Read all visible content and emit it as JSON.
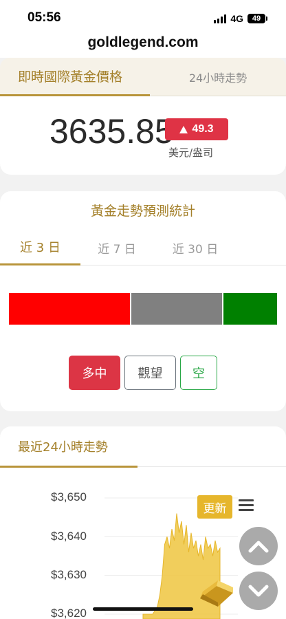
{
  "status": {
    "time": "05:56",
    "network": "4G",
    "battery": "49"
  },
  "browser": {
    "url": "goldlegend.com"
  },
  "price_card": {
    "tab_active": "即時國際黃金價格",
    "tab_other": "24小時走勢",
    "price": "3635.85",
    "change": "49.3",
    "change_direction": "up",
    "unit": "美元/盎司",
    "colors": {
      "up": "#df3345",
      "accent": "#a4802a"
    }
  },
  "forecast": {
    "title": "黃金走勢預測統計",
    "tabs": [
      {
        "label": "近 3 日",
        "active": true
      },
      {
        "label": "近 7 日",
        "active": false
      },
      {
        "label": "近 30 日",
        "active": false
      }
    ],
    "distribution": [
      {
        "name": "bullish",
        "share": 0.45,
        "color": "#ff0000"
      },
      {
        "name": "neutral",
        "share": 0.35,
        "color": "#808080"
      },
      {
        "name": "bearish",
        "share": 0.2,
        "color": "#008000"
      }
    ],
    "buttons": {
      "bull": "多中",
      "watch": "觀望",
      "bear": "空"
    }
  },
  "chart_section": {
    "tab": "最近24小時走勢",
    "update_label": "更新",
    "menu_icon": "hamburger-menu-icon",
    "y_ticks": [
      "$3,650",
      "$3,640",
      "$3,630",
      "$3,620"
    ],
    "scroll_up_icon": "chevron-up-icon",
    "scroll_down_icon": "chevron-down-icon"
  },
  "chart_data": {
    "type": "area",
    "y_ticks": [
      3650,
      3640,
      3630,
      3620
    ],
    "ylim": [
      3620,
      3650
    ],
    "values": [
      3620,
      3620,
      3620,
      3620,
      3620,
      3621,
      3622,
      3625,
      3630,
      3638,
      3640,
      3637,
      3642,
      3639,
      3646,
      3641,
      3644,
      3638,
      3643,
      3636,
      3641,
      3637,
      3639,
      3635,
      3638,
      3634,
      3640,
      3637,
      3638,
      3635,
      3639,
      3636,
      3637
    ],
    "color": "#f0c94a"
  }
}
